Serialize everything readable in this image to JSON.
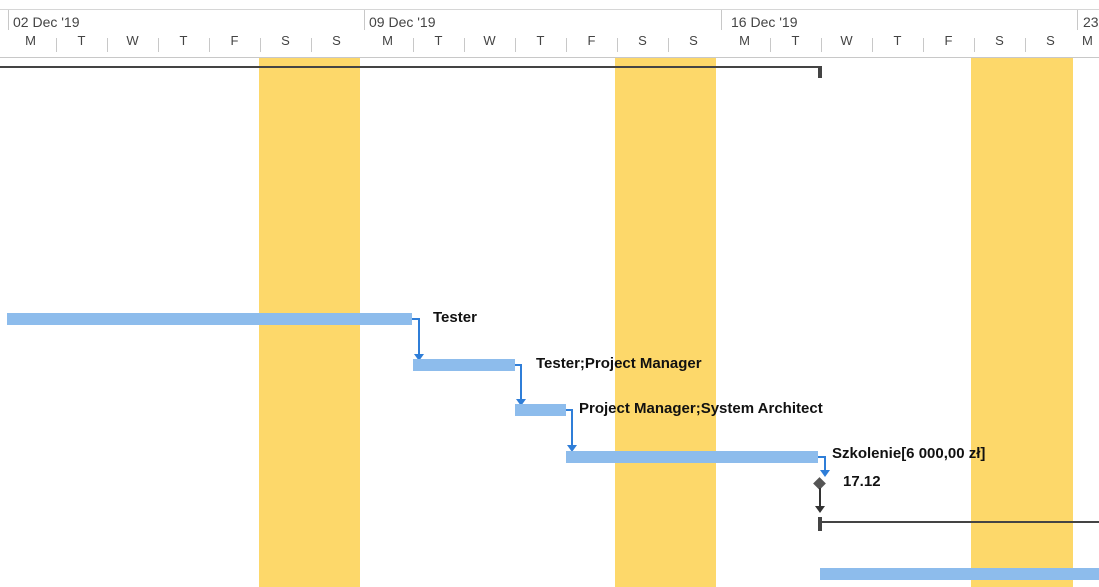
{
  "timescale": {
    "weeks": [
      "02 Dec '19",
      "09 Dec '19",
      "16 Dec '19",
      "23"
    ],
    "days": [
      "M",
      "T",
      "W",
      "T",
      "F",
      "S",
      "S",
      "M",
      "T",
      "W",
      "T",
      "F",
      "S",
      "S",
      "M",
      "T",
      "W",
      "T",
      "F",
      "S",
      "S",
      "M"
    ]
  },
  "tasks": [
    {
      "resource_label": "Tester"
    },
    {
      "resource_label": "Tester;Project Manager"
    },
    {
      "resource_label": "Project Manager;System Architect"
    },
    {
      "resource_label": "Szkolenie[6 000,00 zł]"
    }
  ],
  "milestone": {
    "date_label": "17.12"
  },
  "colors": {
    "weekend": "#fdd86a",
    "task_bar": "#8dbcec",
    "link": "#2f7ed8",
    "summary": "#444444"
  }
}
